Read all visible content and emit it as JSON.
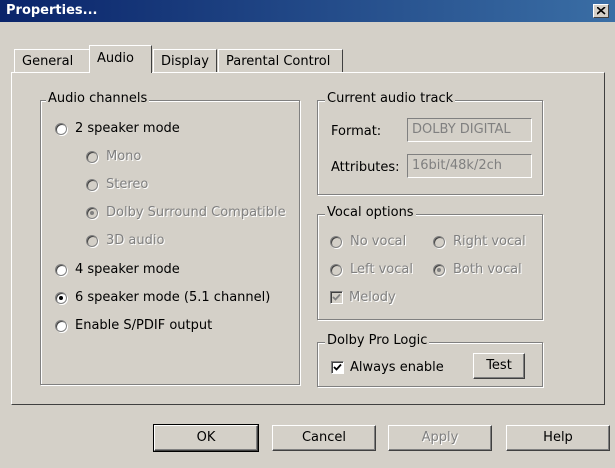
{
  "window": {
    "title": "Properties..."
  },
  "tabs": [
    {
      "label": "General"
    },
    {
      "label": "Audio",
      "active": true
    },
    {
      "label": "Display"
    },
    {
      "label": "Parental Control"
    }
  ],
  "audio_channels": {
    "title": "Audio channels",
    "options": [
      {
        "label": "2 speaker mode",
        "checked": false,
        "enabled": true
      },
      {
        "label": "Mono",
        "checked": false,
        "enabled": false
      },
      {
        "label": "Stereo",
        "checked": false,
        "enabled": false
      },
      {
        "label": "Dolby Surround Compatible",
        "checked": true,
        "enabled": false
      },
      {
        "label": "3D audio",
        "checked": false,
        "enabled": false
      },
      {
        "label": "4 speaker mode",
        "checked": false,
        "enabled": true
      },
      {
        "label": "6 speaker mode (5.1 channel)",
        "checked": true,
        "enabled": true
      },
      {
        "label": "Enable S/PDIF output",
        "checked": false,
        "enabled": true
      }
    ]
  },
  "current_track": {
    "title": "Current audio track",
    "format_label": "Format:",
    "format_value": "DOLBY DIGITAL",
    "attributes_label": "Attributes:",
    "attributes_value": "16bit/48k/2ch"
  },
  "vocal_options": {
    "title": "Vocal options",
    "no_vocal": "No vocal",
    "right_vocal": "Right vocal",
    "left_vocal": "Left vocal",
    "both_vocal": "Both vocal",
    "melody": "Melody",
    "selected": "Both vocal",
    "melody_checked": true
  },
  "dolby_pro_logic": {
    "title": "Dolby Pro Logic",
    "always_enable": "Always enable",
    "always_enable_checked": true,
    "test_button": "Test"
  },
  "buttons": {
    "ok": "OK",
    "cancel": "Cancel",
    "apply": "Apply",
    "help": "Help"
  },
  "colors": {
    "face": "#d4d0c8",
    "title_start": "#0a246a",
    "title_end": "#3a6ea5",
    "disabled_text": "#808080"
  }
}
